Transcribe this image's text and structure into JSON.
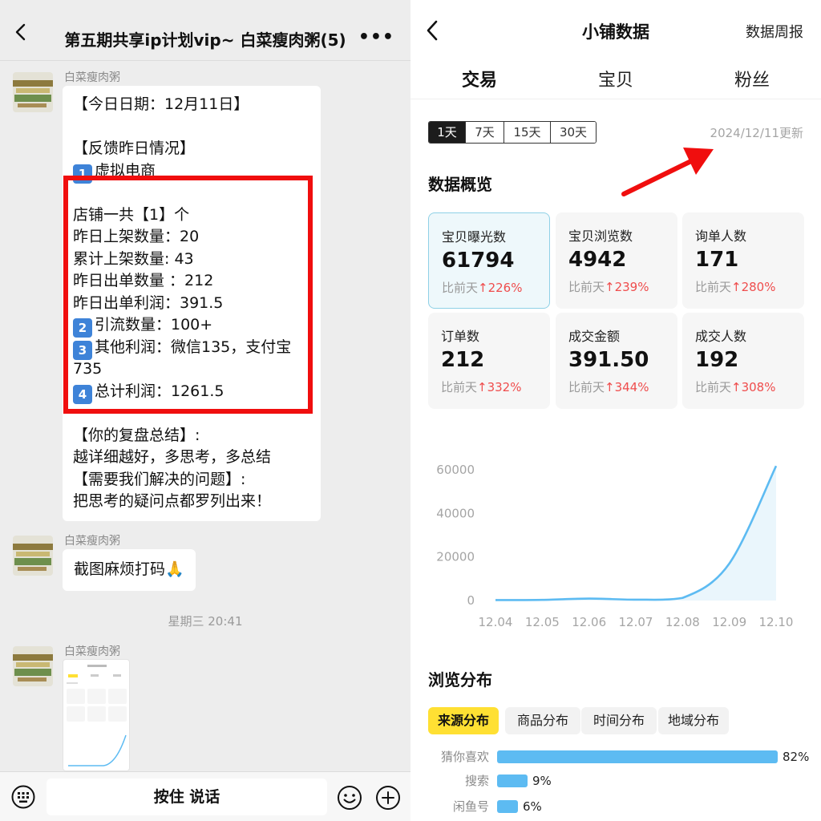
{
  "chat": {
    "title": "第五期共享ip计划vip~ 白菜瘦肉粥(5)",
    "more": "•••",
    "messages": [
      {
        "sender": "白菜瘦肉粥",
        "lines": [
          "【今日日期：12月11日】",
          "",
          "【反馈昨日情况】",
          "虚拟电商",
          "",
          "店铺一共【1】个",
          "昨日上架数量：20",
          "累计上架数量: 43",
          "昨日出单数量 ：212",
          "昨日出单利润：391.5",
          "引流数量：100+",
          "其他利润：微信135，支付宝",
          "735",
          "总计利润：1261.5",
          "",
          "【你的复盘总结】:",
          "越详细越好，多思考，多总结",
          "【需要我们解决的问题】:",
          "把思考的疑问点都罗列出来！"
        ],
        "keycaps": {
          "3": "1",
          "10": "2",
          "11": "3",
          "13": "4"
        }
      },
      {
        "sender": "白菜瘦肉粥",
        "text": "截图麻烦打码🙏"
      },
      {
        "sender": "白菜瘦肉粥",
        "type": "image-thumbnail"
      }
    ],
    "timestamp": "星期三 20:41",
    "hold_to_talk": "按住 说话"
  },
  "page": {
    "title": "小铺数据",
    "weekly_report": "数据周报",
    "tabs": [
      "交易",
      "宝贝",
      "粉丝"
    ],
    "active_tab": 0,
    "ranges": [
      "1天",
      "7天",
      "15天",
      "30天"
    ],
    "active_range": 0,
    "updated": "2024/12/11更新",
    "overview_title": "数据概览",
    "compare_prefix": "比前天",
    "metrics": [
      {
        "label": "宝贝曝光数",
        "value": "61794",
        "change": "226%"
      },
      {
        "label": "宝贝浏览数",
        "value": "4942",
        "change": "239%"
      },
      {
        "label": "询单人数",
        "value": "171",
        "change": "280%"
      },
      {
        "label": "订单数",
        "value": "212",
        "change": "332%"
      },
      {
        "label": "成交金额",
        "value": "391.50",
        "change": "344%"
      },
      {
        "label": "成交人数",
        "value": "192",
        "change": "308%"
      }
    ],
    "browse_title": "浏览分布",
    "browse_pills": [
      "来源分布",
      "商品分布",
      "时间分布",
      "地域分布"
    ],
    "active_pill": 0,
    "distribution": [
      {
        "label": "猜你喜欢",
        "pct": "82%",
        "value": 82
      },
      {
        "label": "搜索",
        "pct": "9%",
        "value": 9
      },
      {
        "label": "闲鱼号",
        "pct": "6%",
        "value": 6
      }
    ],
    "accent": "#ffe033",
    "up_color": "#ef4d4d",
    "line_color": "#5dbbf2"
  },
  "chart_data": {
    "type": "area",
    "categories": [
      "12.04",
      "12.05",
      "12.06",
      "12.07",
      "12.08",
      "12.09",
      "12.10"
    ],
    "values": [
      200,
      300,
      900,
      400,
      1200,
      17000,
      61794
    ],
    "yticks": [
      0,
      20000,
      40000,
      60000
    ],
    "ylim": [
      0,
      62000
    ]
  }
}
